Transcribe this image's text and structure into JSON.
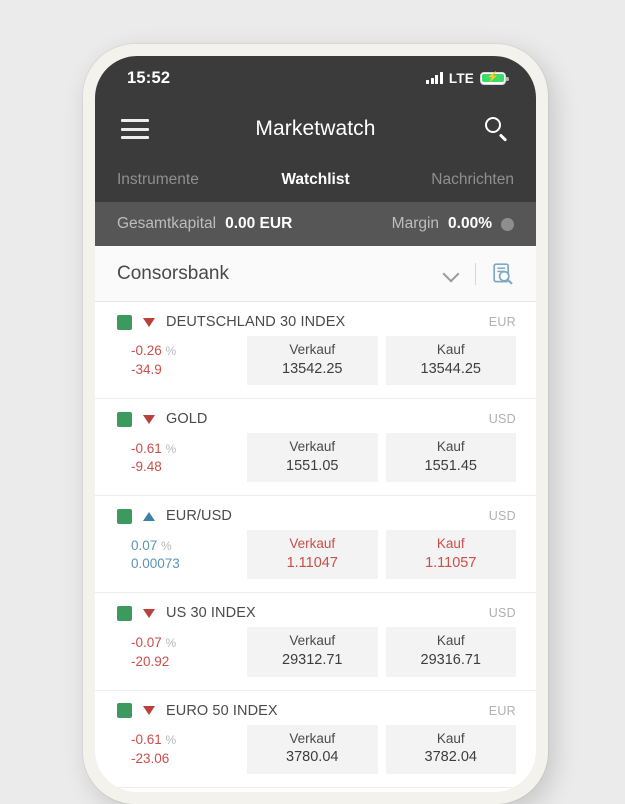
{
  "status_bar": {
    "time": "15:52",
    "network": "LTE",
    "signal_icon": "signal-bars-icon",
    "battery_icon": "battery-charging-icon"
  },
  "app_bar": {
    "menu_icon": "hamburger-menu-icon",
    "title": "Marketwatch",
    "search_icon": "search-icon"
  },
  "tabs": [
    {
      "label": "Instrumente",
      "active": false
    },
    {
      "label": "Watchlist",
      "active": true
    },
    {
      "label": "Nachrichten",
      "active": false
    }
  ],
  "account_bar": {
    "capital_label": "Gesamtkapital",
    "capital_value": "0.00 EUR",
    "margin_label": "Margin",
    "margin_value": "0.00%",
    "margin_indicator_color": "#8e8e8e"
  },
  "broker": {
    "name": "Consorsbank",
    "chevron_icon": "chevron-down-icon",
    "document_search_icon": "document-search-icon",
    "document_search_color": "#7ea9c2"
  },
  "colors": {
    "negative": "#cb4f4a",
    "positive": "#5b93b5",
    "status_square": "#3d9a5e",
    "header": "#3b3b3b",
    "account_bar": "#565656"
  },
  "price_headers": {
    "sell": "Verkauf",
    "buy": "Kauf"
  },
  "instruments": [
    {
      "name": "DEUTSCHLAND 30 INDEX",
      "currency": "EUR",
      "direction": "down",
      "status": "open",
      "change_pct": "-0.26",
      "pct_symbol": "%",
      "change_abs": "-34.9",
      "change_sign": "negative",
      "sell_label": "Verkauf",
      "sell_price": "13542.25",
      "buy_label": "Kauf",
      "buy_price": "13544.25",
      "price_tick": "neutral"
    },
    {
      "name": "GOLD",
      "currency": "USD",
      "direction": "down",
      "status": "open",
      "change_pct": "-0.61",
      "pct_symbol": "%",
      "change_abs": "-9.48",
      "change_sign": "negative",
      "sell_label": "Verkauf",
      "sell_price": "1551.05",
      "buy_label": "Kauf",
      "buy_price": "1551.45",
      "price_tick": "neutral"
    },
    {
      "name": "EUR/USD",
      "currency": "USD",
      "direction": "up",
      "status": "open",
      "change_pct": "0.07",
      "pct_symbol": "%",
      "change_abs": "0.00073",
      "change_sign": "positive",
      "sell_label": "Verkauf",
      "sell_price": "1.11047",
      "buy_label": "Kauf",
      "buy_price": "1.11057",
      "price_tick": "down"
    },
    {
      "name": "US 30 INDEX",
      "currency": "USD",
      "direction": "down",
      "status": "open",
      "change_pct": "-0.07",
      "pct_symbol": "%",
      "change_abs": "-20.92",
      "change_sign": "negative",
      "sell_label": "Verkauf",
      "sell_price": "29312.71",
      "buy_label": "Kauf",
      "buy_price": "29316.71",
      "price_tick": "neutral"
    },
    {
      "name": "EURO 50 INDEX",
      "currency": "EUR",
      "direction": "down",
      "status": "open",
      "change_pct": "-0.61",
      "pct_symbol": "%",
      "change_abs": "-23.06",
      "change_sign": "negative",
      "sell_label": "Verkauf",
      "sell_price": "3780.04",
      "buy_label": "Kauf",
      "buy_price": "3782.04",
      "price_tick": "neutral"
    }
  ]
}
